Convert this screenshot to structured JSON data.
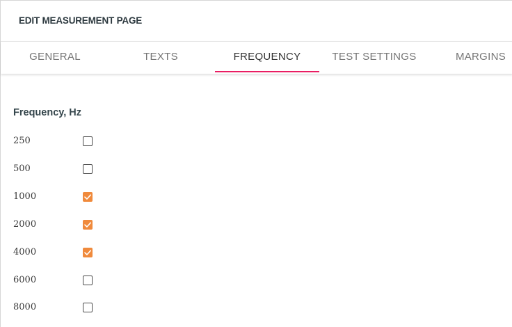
{
  "header": {
    "title": "EDIT MEASUREMENT PAGE"
  },
  "tabs": [
    {
      "label": "GENERAL",
      "active": false
    },
    {
      "label": "TEXTS",
      "active": false
    },
    {
      "label": "FREQUENCY",
      "active": true
    },
    {
      "label": "TEST SETTINGS",
      "active": false
    },
    {
      "label": "MARGINS",
      "active": false
    }
  ],
  "frequency": {
    "title": "Frequency, Hz",
    "items": [
      {
        "value": "250",
        "checked": false
      },
      {
        "value": "500",
        "checked": false
      },
      {
        "value": "1000",
        "checked": true
      },
      {
        "value": "2000",
        "checked": true
      },
      {
        "value": "4000",
        "checked": true
      },
      {
        "value": "6000",
        "checked": false
      },
      {
        "value": "8000",
        "checked": false
      }
    ]
  },
  "colors": {
    "accent_tab_indicator": "#e91e63",
    "checkbox_checked": "#f08a3c"
  }
}
